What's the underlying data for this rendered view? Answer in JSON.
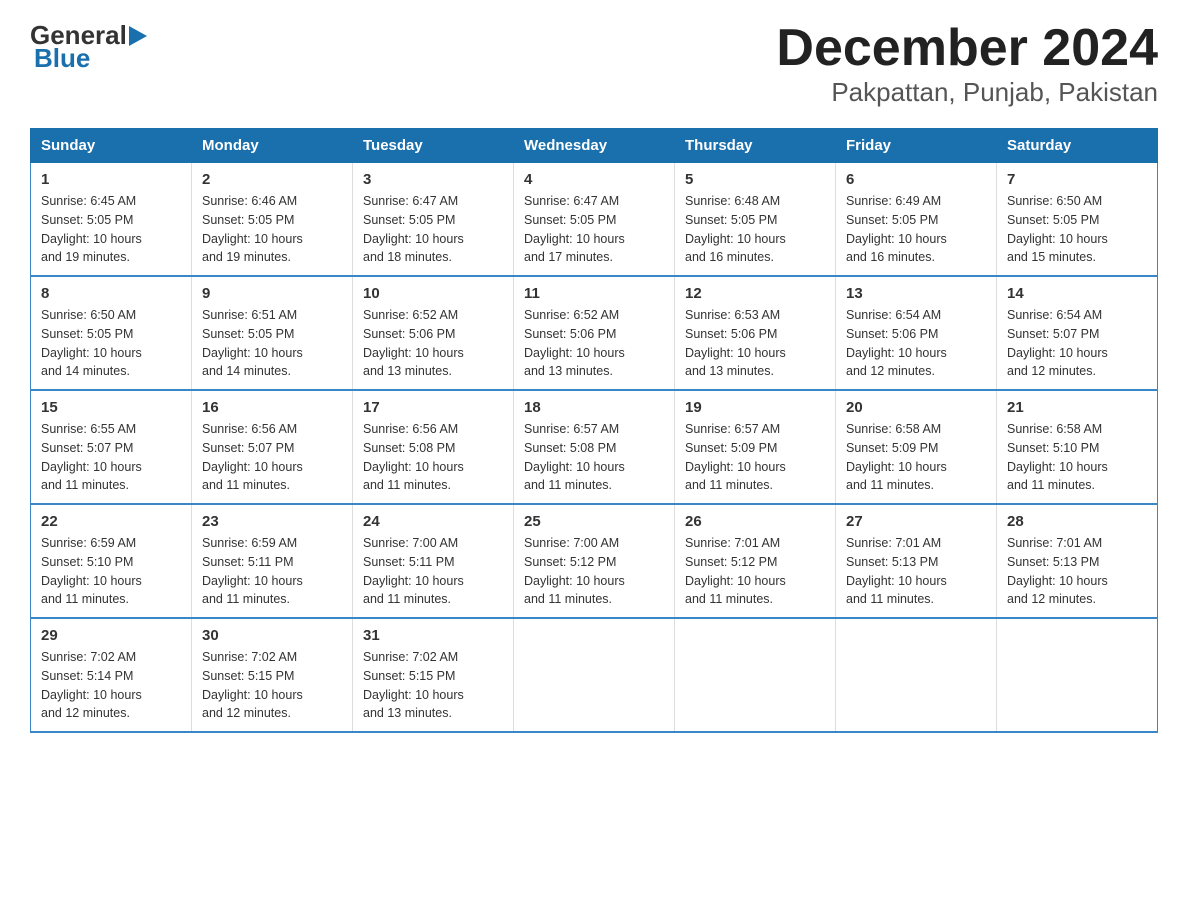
{
  "logo": {
    "general": "General",
    "blue": "Blue"
  },
  "title": "December 2024",
  "subtitle": "Pakpattan, Punjab, Pakistan",
  "days_of_week": [
    "Sunday",
    "Monday",
    "Tuesday",
    "Wednesday",
    "Thursday",
    "Friday",
    "Saturday"
  ],
  "weeks": [
    [
      {
        "day": "1",
        "sunrise": "6:45 AM",
        "sunset": "5:05 PM",
        "daylight": "10 hours and 19 minutes."
      },
      {
        "day": "2",
        "sunrise": "6:46 AM",
        "sunset": "5:05 PM",
        "daylight": "10 hours and 19 minutes."
      },
      {
        "day": "3",
        "sunrise": "6:47 AM",
        "sunset": "5:05 PM",
        "daylight": "10 hours and 18 minutes."
      },
      {
        "day": "4",
        "sunrise": "6:47 AM",
        "sunset": "5:05 PM",
        "daylight": "10 hours and 17 minutes."
      },
      {
        "day": "5",
        "sunrise": "6:48 AM",
        "sunset": "5:05 PM",
        "daylight": "10 hours and 16 minutes."
      },
      {
        "day": "6",
        "sunrise": "6:49 AM",
        "sunset": "5:05 PM",
        "daylight": "10 hours and 16 minutes."
      },
      {
        "day": "7",
        "sunrise": "6:50 AM",
        "sunset": "5:05 PM",
        "daylight": "10 hours and 15 minutes."
      }
    ],
    [
      {
        "day": "8",
        "sunrise": "6:50 AM",
        "sunset": "5:05 PM",
        "daylight": "10 hours and 14 minutes."
      },
      {
        "day": "9",
        "sunrise": "6:51 AM",
        "sunset": "5:05 PM",
        "daylight": "10 hours and 14 minutes."
      },
      {
        "day": "10",
        "sunrise": "6:52 AM",
        "sunset": "5:06 PM",
        "daylight": "10 hours and 13 minutes."
      },
      {
        "day": "11",
        "sunrise": "6:52 AM",
        "sunset": "5:06 PM",
        "daylight": "10 hours and 13 minutes."
      },
      {
        "day": "12",
        "sunrise": "6:53 AM",
        "sunset": "5:06 PM",
        "daylight": "10 hours and 13 minutes."
      },
      {
        "day": "13",
        "sunrise": "6:54 AM",
        "sunset": "5:06 PM",
        "daylight": "10 hours and 12 minutes."
      },
      {
        "day": "14",
        "sunrise": "6:54 AM",
        "sunset": "5:07 PM",
        "daylight": "10 hours and 12 minutes."
      }
    ],
    [
      {
        "day": "15",
        "sunrise": "6:55 AM",
        "sunset": "5:07 PM",
        "daylight": "10 hours and 11 minutes."
      },
      {
        "day": "16",
        "sunrise": "6:56 AM",
        "sunset": "5:07 PM",
        "daylight": "10 hours and 11 minutes."
      },
      {
        "day": "17",
        "sunrise": "6:56 AM",
        "sunset": "5:08 PM",
        "daylight": "10 hours and 11 minutes."
      },
      {
        "day": "18",
        "sunrise": "6:57 AM",
        "sunset": "5:08 PM",
        "daylight": "10 hours and 11 minutes."
      },
      {
        "day": "19",
        "sunrise": "6:57 AM",
        "sunset": "5:09 PM",
        "daylight": "10 hours and 11 minutes."
      },
      {
        "day": "20",
        "sunrise": "6:58 AM",
        "sunset": "5:09 PM",
        "daylight": "10 hours and 11 minutes."
      },
      {
        "day": "21",
        "sunrise": "6:58 AM",
        "sunset": "5:10 PM",
        "daylight": "10 hours and 11 minutes."
      }
    ],
    [
      {
        "day": "22",
        "sunrise": "6:59 AM",
        "sunset": "5:10 PM",
        "daylight": "10 hours and 11 minutes."
      },
      {
        "day": "23",
        "sunrise": "6:59 AM",
        "sunset": "5:11 PM",
        "daylight": "10 hours and 11 minutes."
      },
      {
        "day": "24",
        "sunrise": "7:00 AM",
        "sunset": "5:11 PM",
        "daylight": "10 hours and 11 minutes."
      },
      {
        "day": "25",
        "sunrise": "7:00 AM",
        "sunset": "5:12 PM",
        "daylight": "10 hours and 11 minutes."
      },
      {
        "day": "26",
        "sunrise": "7:01 AM",
        "sunset": "5:12 PM",
        "daylight": "10 hours and 11 minutes."
      },
      {
        "day": "27",
        "sunrise": "7:01 AM",
        "sunset": "5:13 PM",
        "daylight": "10 hours and 11 minutes."
      },
      {
        "day": "28",
        "sunrise": "7:01 AM",
        "sunset": "5:13 PM",
        "daylight": "10 hours and 12 minutes."
      }
    ],
    [
      {
        "day": "29",
        "sunrise": "7:02 AM",
        "sunset": "5:14 PM",
        "daylight": "10 hours and 12 minutes."
      },
      {
        "day": "30",
        "sunrise": "7:02 AM",
        "sunset": "5:15 PM",
        "daylight": "10 hours and 12 minutes."
      },
      {
        "day": "31",
        "sunrise": "7:02 AM",
        "sunset": "5:15 PM",
        "daylight": "10 hours and 13 minutes."
      },
      null,
      null,
      null,
      null
    ]
  ],
  "labels": {
    "sunrise": "Sunrise:",
    "sunset": "Sunset:",
    "daylight": "Daylight:"
  }
}
